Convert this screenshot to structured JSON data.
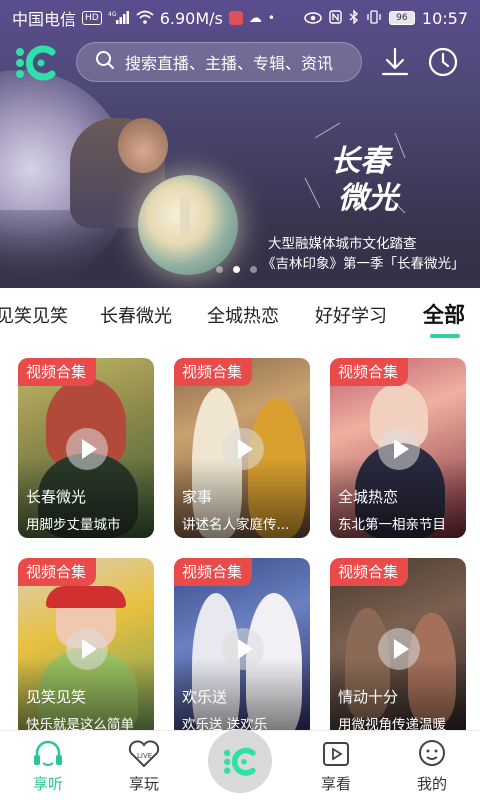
{
  "status_bar": {
    "carrier": "中国电信",
    "hd": "HD",
    "network": "4G",
    "speed": "6.90M/s",
    "battery": "96",
    "time": "10:57"
  },
  "top_bar": {
    "search_placeholder": "搜索直播、主播、专辑、资讯"
  },
  "banner": {
    "logo_text_1": "长春",
    "logo_text_2": "微光",
    "line1": "大型融媒体城市文化踏查",
    "line2": "《吉林印象》第一季「长春微光」",
    "dots": 3,
    "active_dot": 1
  },
  "tabs": [
    {
      "label": "见笑见笑"
    },
    {
      "label": "长春微光"
    },
    {
      "label": "全城热恋"
    },
    {
      "label": "好好学习"
    },
    {
      "label": "全部"
    }
  ],
  "cards": [
    {
      "tag": "视频合集",
      "title": "长春微光",
      "subtitle": "用脚步丈量城市"
    },
    {
      "tag": "视频合集",
      "title": "家事",
      "subtitle": "讲述名人家庭传..."
    },
    {
      "tag": "视频合集",
      "title": "全城热恋",
      "subtitle": "东北第一相亲节目"
    },
    {
      "tag": "视频合集",
      "title": "见笑见笑",
      "subtitle": "快乐就是这么简单"
    },
    {
      "tag": "视频合集",
      "title": "欢乐送",
      "subtitle": "欢乐送 送欢乐"
    },
    {
      "tag": "视频合集",
      "title": "情动十分",
      "subtitle": "用微视角传递温暖"
    }
  ],
  "bottom_nav": [
    {
      "label": "享听"
    },
    {
      "label": "享玩"
    },
    {
      "label": ""
    },
    {
      "label": "享看"
    },
    {
      "label": "我的"
    }
  ],
  "colors": {
    "accent": "#27c796",
    "tag_red": "#e94b4b"
  }
}
